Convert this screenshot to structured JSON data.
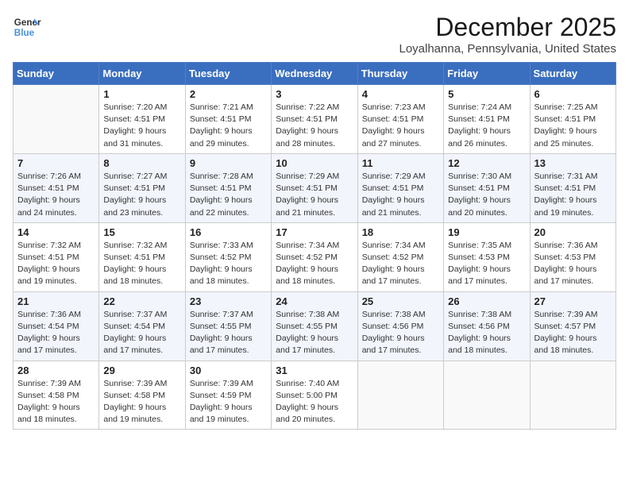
{
  "header": {
    "logo_line1": "General",
    "logo_line2": "Blue",
    "month_title": "December 2025",
    "subtitle": "Loyalhanna, Pennsylvania, United States"
  },
  "weekdays": [
    "Sunday",
    "Monday",
    "Tuesday",
    "Wednesday",
    "Thursday",
    "Friday",
    "Saturday"
  ],
  "weeks": [
    [
      {
        "day": "",
        "info": ""
      },
      {
        "day": "1",
        "info": "Sunrise: 7:20 AM\nSunset: 4:51 PM\nDaylight: 9 hours\nand 31 minutes."
      },
      {
        "day": "2",
        "info": "Sunrise: 7:21 AM\nSunset: 4:51 PM\nDaylight: 9 hours\nand 29 minutes."
      },
      {
        "day": "3",
        "info": "Sunrise: 7:22 AM\nSunset: 4:51 PM\nDaylight: 9 hours\nand 28 minutes."
      },
      {
        "day": "4",
        "info": "Sunrise: 7:23 AM\nSunset: 4:51 PM\nDaylight: 9 hours\nand 27 minutes."
      },
      {
        "day": "5",
        "info": "Sunrise: 7:24 AM\nSunset: 4:51 PM\nDaylight: 9 hours\nand 26 minutes."
      },
      {
        "day": "6",
        "info": "Sunrise: 7:25 AM\nSunset: 4:51 PM\nDaylight: 9 hours\nand 25 minutes."
      }
    ],
    [
      {
        "day": "7",
        "info": "Sunrise: 7:26 AM\nSunset: 4:51 PM\nDaylight: 9 hours\nand 24 minutes."
      },
      {
        "day": "8",
        "info": "Sunrise: 7:27 AM\nSunset: 4:51 PM\nDaylight: 9 hours\nand 23 minutes."
      },
      {
        "day": "9",
        "info": "Sunrise: 7:28 AM\nSunset: 4:51 PM\nDaylight: 9 hours\nand 22 minutes."
      },
      {
        "day": "10",
        "info": "Sunrise: 7:29 AM\nSunset: 4:51 PM\nDaylight: 9 hours\nand 21 minutes."
      },
      {
        "day": "11",
        "info": "Sunrise: 7:29 AM\nSunset: 4:51 PM\nDaylight: 9 hours\nand 21 minutes."
      },
      {
        "day": "12",
        "info": "Sunrise: 7:30 AM\nSunset: 4:51 PM\nDaylight: 9 hours\nand 20 minutes."
      },
      {
        "day": "13",
        "info": "Sunrise: 7:31 AM\nSunset: 4:51 PM\nDaylight: 9 hours\nand 19 minutes."
      }
    ],
    [
      {
        "day": "14",
        "info": "Sunrise: 7:32 AM\nSunset: 4:51 PM\nDaylight: 9 hours\nand 19 minutes."
      },
      {
        "day": "15",
        "info": "Sunrise: 7:32 AM\nSunset: 4:51 PM\nDaylight: 9 hours\nand 18 minutes."
      },
      {
        "day": "16",
        "info": "Sunrise: 7:33 AM\nSunset: 4:52 PM\nDaylight: 9 hours\nand 18 minutes."
      },
      {
        "day": "17",
        "info": "Sunrise: 7:34 AM\nSunset: 4:52 PM\nDaylight: 9 hours\nand 18 minutes."
      },
      {
        "day": "18",
        "info": "Sunrise: 7:34 AM\nSunset: 4:52 PM\nDaylight: 9 hours\nand 17 minutes."
      },
      {
        "day": "19",
        "info": "Sunrise: 7:35 AM\nSunset: 4:53 PM\nDaylight: 9 hours\nand 17 minutes."
      },
      {
        "day": "20",
        "info": "Sunrise: 7:36 AM\nSunset: 4:53 PM\nDaylight: 9 hours\nand 17 minutes."
      }
    ],
    [
      {
        "day": "21",
        "info": "Sunrise: 7:36 AM\nSunset: 4:54 PM\nDaylight: 9 hours\nand 17 minutes."
      },
      {
        "day": "22",
        "info": "Sunrise: 7:37 AM\nSunset: 4:54 PM\nDaylight: 9 hours\nand 17 minutes."
      },
      {
        "day": "23",
        "info": "Sunrise: 7:37 AM\nSunset: 4:55 PM\nDaylight: 9 hours\nand 17 minutes."
      },
      {
        "day": "24",
        "info": "Sunrise: 7:38 AM\nSunset: 4:55 PM\nDaylight: 9 hours\nand 17 minutes."
      },
      {
        "day": "25",
        "info": "Sunrise: 7:38 AM\nSunset: 4:56 PM\nDaylight: 9 hours\nand 17 minutes."
      },
      {
        "day": "26",
        "info": "Sunrise: 7:38 AM\nSunset: 4:56 PM\nDaylight: 9 hours\nand 18 minutes."
      },
      {
        "day": "27",
        "info": "Sunrise: 7:39 AM\nSunset: 4:57 PM\nDaylight: 9 hours\nand 18 minutes."
      }
    ],
    [
      {
        "day": "28",
        "info": "Sunrise: 7:39 AM\nSunset: 4:58 PM\nDaylight: 9 hours\nand 18 minutes."
      },
      {
        "day": "29",
        "info": "Sunrise: 7:39 AM\nSunset: 4:58 PM\nDaylight: 9 hours\nand 19 minutes."
      },
      {
        "day": "30",
        "info": "Sunrise: 7:39 AM\nSunset: 4:59 PM\nDaylight: 9 hours\nand 19 minutes."
      },
      {
        "day": "31",
        "info": "Sunrise: 7:40 AM\nSunset: 5:00 PM\nDaylight: 9 hours\nand 20 minutes."
      },
      {
        "day": "",
        "info": ""
      },
      {
        "day": "",
        "info": ""
      },
      {
        "day": "",
        "info": ""
      }
    ]
  ]
}
